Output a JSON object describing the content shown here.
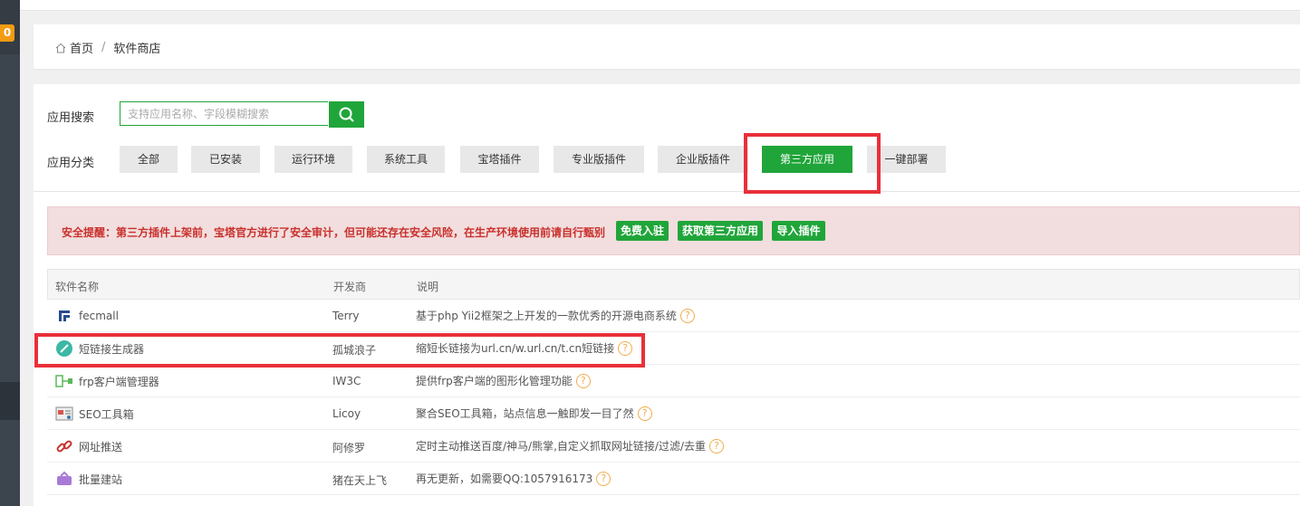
{
  "sidebar": {
    "badge": "0"
  },
  "breadcrumb": {
    "home": "首页",
    "separator": "/",
    "current": "软件商店"
  },
  "search": {
    "label": "应用搜索",
    "placeholder": "支持应用名称、字段模糊搜索"
  },
  "categories": {
    "label": "应用分类",
    "items": [
      "全部",
      "已安装",
      "运行环境",
      "系统工具",
      "宝塔插件",
      "专业版插件",
      "企业版插件",
      "第三方应用",
      "一键部署"
    ],
    "active": "第三方应用"
  },
  "alert": {
    "text": "安全提醒：第三方插件上架前，宝塔官方进行了安全审计，但可能还存在安全风险，在生产环境使用前请自行甄别",
    "buttons": [
      "免费入驻",
      "获取第三方应用",
      "导入插件"
    ]
  },
  "table": {
    "headers": [
      "软件名称",
      "开发商",
      "说明"
    ],
    "rows": [
      {
        "name": "fecmall",
        "developer": "Terry",
        "desc": "基于php Yii2框架之上开发的一款优秀的开源电商系统",
        "icon": "fecmall-icon"
      },
      {
        "name": "短链接生成器",
        "developer": "孤城浪子",
        "desc": "缩短长链接为url.cn/w.url.cn/t.cn短链接",
        "icon": "short-link-icon"
      },
      {
        "name": "frp客户端管理器",
        "developer": "IW3C",
        "desc": "提供frp客户端的图形化管理功能",
        "icon": "frp-icon"
      },
      {
        "name": "SEO工具箱",
        "developer": "Licoy",
        "desc": "聚合SEO工具箱，站点信息一触即发一目了然",
        "icon": "seo-toolbox-icon"
      },
      {
        "name": "网址推送",
        "developer": "阿修罗",
        "desc": "定时主动推送百度/神马/熊掌,自定义抓取网址链接/过滤/去重",
        "icon": "url-push-icon"
      },
      {
        "name": "批量建站",
        "developer": "猪在天上飞",
        "desc": "再无更新，如需要QQ:1057916173",
        "icon": "batch-site-icon"
      }
    ],
    "help_symbol": "?"
  },
  "colors": {
    "accent": "#20a53a",
    "highlight": "#e9303a",
    "alert_text": "#c9302c"
  }
}
